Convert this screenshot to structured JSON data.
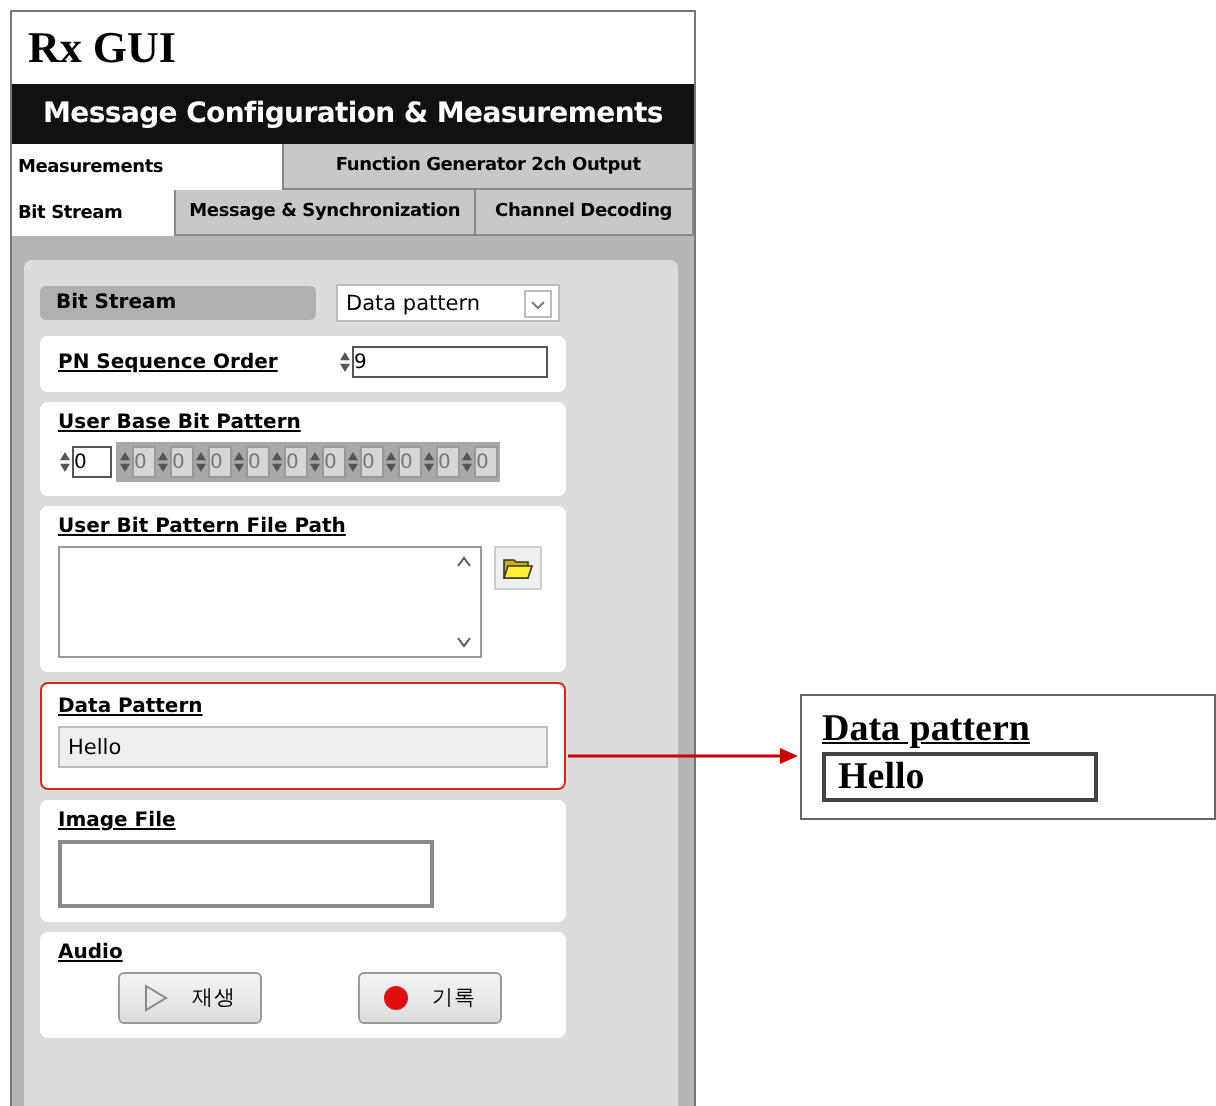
{
  "window": {
    "title": "Rx GUI"
  },
  "header": "Message Configuration & Measurements",
  "tabs_top": [
    {
      "label": "Measurements",
      "selected": true
    },
    {
      "label": "Function Generator 2ch Output",
      "selected": false
    }
  ],
  "tabs_sub": [
    {
      "label": "Bit Stream",
      "selected": true
    },
    {
      "label": "Message & Synchronization",
      "selected": false
    },
    {
      "label": "Channel Decoding",
      "selected": false
    }
  ],
  "bit_stream": {
    "label": "Bit Stream",
    "value": "Data pattern"
  },
  "pn_sequence": {
    "label": "PN Sequence Order",
    "value": "9"
  },
  "user_base_bit_pattern": {
    "label": "User Base Bit Pattern",
    "index": "0",
    "bits": [
      "0",
      "0",
      "0",
      "0",
      "0",
      "0",
      "0",
      "0",
      "0",
      "0"
    ]
  },
  "file_path": {
    "label": "User Bit Pattern File Path"
  },
  "data_pattern": {
    "label": "Data Pattern",
    "value": "Hello",
    "highlighted": true
  },
  "image_file": {
    "label": "Image File"
  },
  "audio": {
    "label": "Audio",
    "buttons": [
      {
        "label": "재생",
        "kind": "play"
      },
      {
        "label": "기록",
        "kind": "record"
      }
    ]
  },
  "callout": {
    "label": "Data pattern",
    "value": "Hello"
  }
}
